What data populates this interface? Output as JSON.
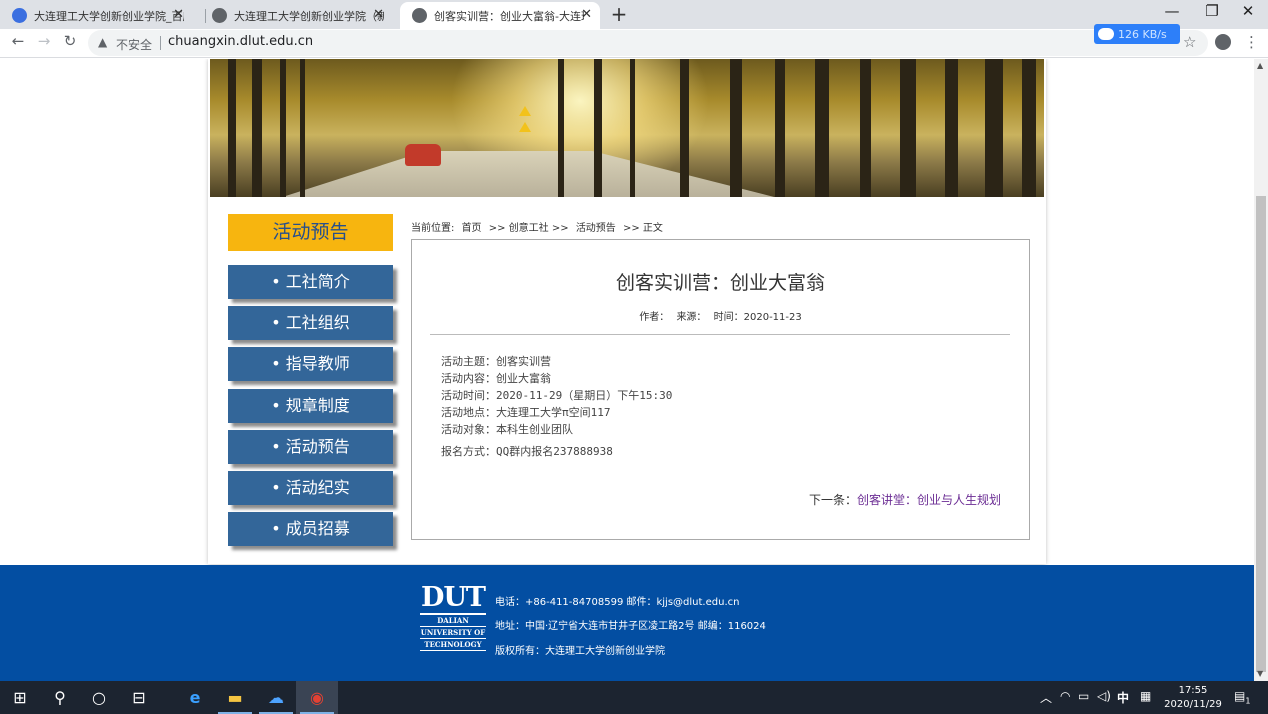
{
  "browser": {
    "tabs": [
      {
        "title": "大连理工大学创新创业学院_百度",
        "active": false
      },
      {
        "title": "大连理工大学创新创业学院（新）",
        "active": false
      },
      {
        "title": "创客实训营：创业大富翁-大连理",
        "active": true
      }
    ],
    "address": {
      "security_label": "不安全",
      "url": "chuangxin.dlut.edu.cn"
    },
    "download_speed": "126 KB/s"
  },
  "sidebar": {
    "title": "活动预告",
    "items": [
      {
        "label": "• 工社简介"
      },
      {
        "label": "• 工社组织"
      },
      {
        "label": "• 指导教师"
      },
      {
        "label": "• 规章制度"
      },
      {
        "label": "• 活动预告"
      },
      {
        "label": "• 活动纪实"
      },
      {
        "label": "• 成员招募"
      }
    ]
  },
  "breadcrumb": {
    "prefix": "当前位置:",
    "home": "首页",
    "sep1": ">> 创意工社 >>",
    "section": "活动预告",
    "sep2": ">> 正文"
  },
  "article": {
    "title": "创客实训营：创业大富翁",
    "meta": {
      "author": "作者：",
      "source": "来源：",
      "time": "时间：2020-11-23"
    },
    "lines": [
      "活动主题：创客实训营",
      "活动内容：创业大富翁",
      "活动时间：2020-11-29（星期日）下午15:30",
      "活动地点：大连理工大学π空间117",
      "活动对象：本科生创业团队",
      "报名方式：QQ群内报名237888938"
    ],
    "next_label": "下一条：",
    "next_link": "创客讲堂：创业与人生规划"
  },
  "footer": {
    "logo_big": "DUT",
    "logo_lines": [
      "DALIAN",
      "UNIVERSITY OF",
      "TECHNOLOGY"
    ],
    "phone_line": "电话：+86-411-84708599 邮件：kjjs@dlut.edu.cn",
    "address_line": "地址：中国·辽宁省大连市甘井子区凌工路2号 邮编：116024",
    "copyright_line": "版权所有：大连理工大学创新创业学院"
  },
  "taskbar": {
    "ime": "中",
    "time": "17:55",
    "date": "2020/11/29",
    "notification_count": "1"
  },
  "colors": {
    "sidebar_title_bg": "#f7b50f",
    "sidebar_item_bg": "#336699",
    "footer_bg": "#034ea2",
    "link": "#6b2d94"
  }
}
